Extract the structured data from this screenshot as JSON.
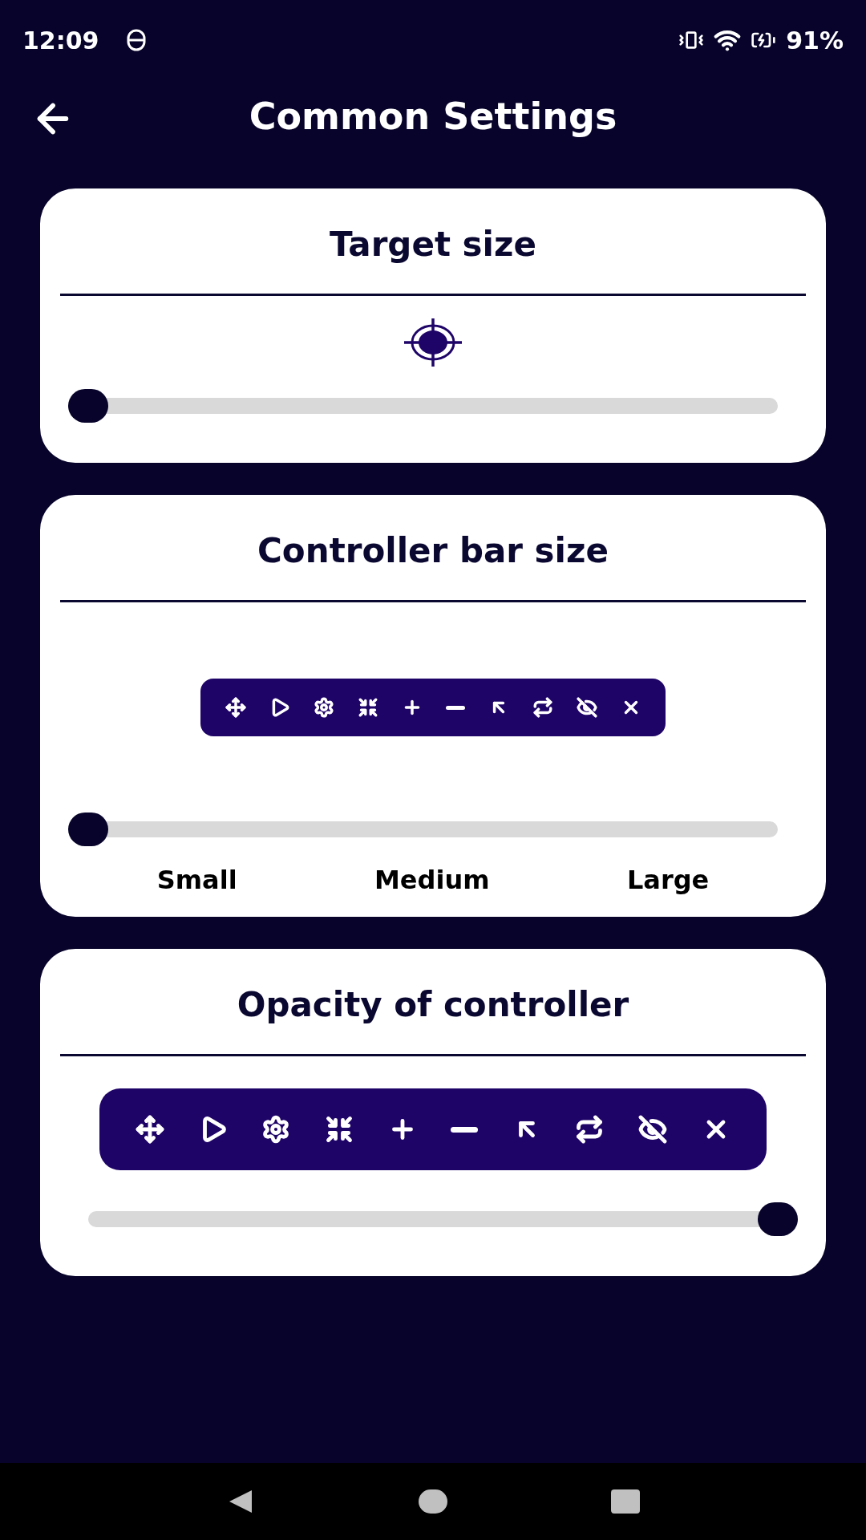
{
  "status_bar": {
    "time": "12:09",
    "battery": "91%"
  },
  "header": {
    "title": "Common Settings"
  },
  "cards": [
    {
      "kind": "target",
      "title": "Target size",
      "slider": {
        "level": 0
      }
    },
    {
      "kind": "bar",
      "title": "Controller bar size",
      "slider": {
        "level": 0
      },
      "scale_labels": [
        "Small",
        "Medium",
        "Large"
      ]
    },
    {
      "kind": "opacity",
      "title": "Opacity of controller",
      "slider": {
        "level": 1
      }
    }
  ]
}
